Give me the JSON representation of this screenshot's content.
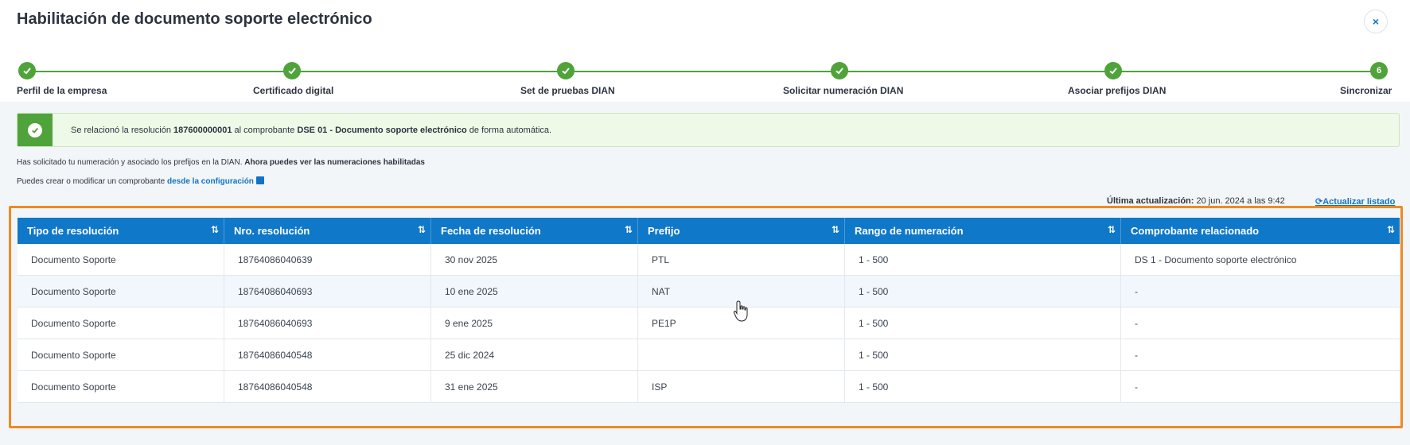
{
  "modal": {
    "title": "Habilitación de documento soporte electrónico",
    "close_icon": "×"
  },
  "stepper": {
    "steps": [
      {
        "label": "Perfil de la empresa",
        "state": "done"
      },
      {
        "label": "Certificado digital",
        "state": "done"
      },
      {
        "label": "Set de pruebas DIAN",
        "state": "done"
      },
      {
        "label": "Solicitar numeración DIAN",
        "state": "done"
      },
      {
        "label": "Asociar prefijos DIAN",
        "state": "done"
      },
      {
        "label": "Sincronizar",
        "state": "current",
        "number": "6"
      }
    ]
  },
  "alert": {
    "prefix": "Se relacionó la resolución ",
    "resolution": "187600000001",
    "middle": " al comprobante ",
    "voucher": "DSE 01 - Documento soporte electrónico",
    "suffix": " de forma automática."
  },
  "info": {
    "line1_text": "Has solicitado tu numeración y asociado los prefijos en la DIAN. ",
    "line1_bold": "Ahora puedes ver las numeraciones habilitadas",
    "line2_text": "Puedes crear o modificar un comprobante ",
    "line2_link": "desde la configuración"
  },
  "update": {
    "label": "Última actualización:",
    "value": " 20 jun. 2024 a las 9:42",
    "refresh_label": "Actualizar listado"
  },
  "table": {
    "columns": [
      "Tipo de resolución",
      "Nro. resolución",
      "Fecha de resolución",
      "Prefijo",
      "Rango de numeración",
      "Comprobante relacionado"
    ],
    "sort_icon": "⇅",
    "rows": [
      [
        "Documento Soporte",
        "18764086040639",
        "30 nov 2025",
        "PTL",
        "1 - 500",
        "DS 1 - Documento soporte electrónico"
      ],
      [
        "Documento Soporte",
        "18764086040693",
        "10 ene 2025",
        "NAT",
        "1 - 500",
        "-"
      ],
      [
        "Documento Soporte",
        "18764086040693",
        "9 ene 2025",
        "PE1P",
        "1 - 500",
        "-"
      ],
      [
        "Documento Soporte",
        "18764086040548",
        "25 dic 2024",
        "",
        "1 - 500",
        "-"
      ],
      [
        "Documento Soporte",
        "18764086040548",
        "31 ene 2025",
        "ISP",
        "1 - 500",
        "-"
      ]
    ]
  },
  "colors": {
    "accent": "#0f78c8",
    "success": "#4fa33a",
    "highlight": "#ee8a22"
  }
}
